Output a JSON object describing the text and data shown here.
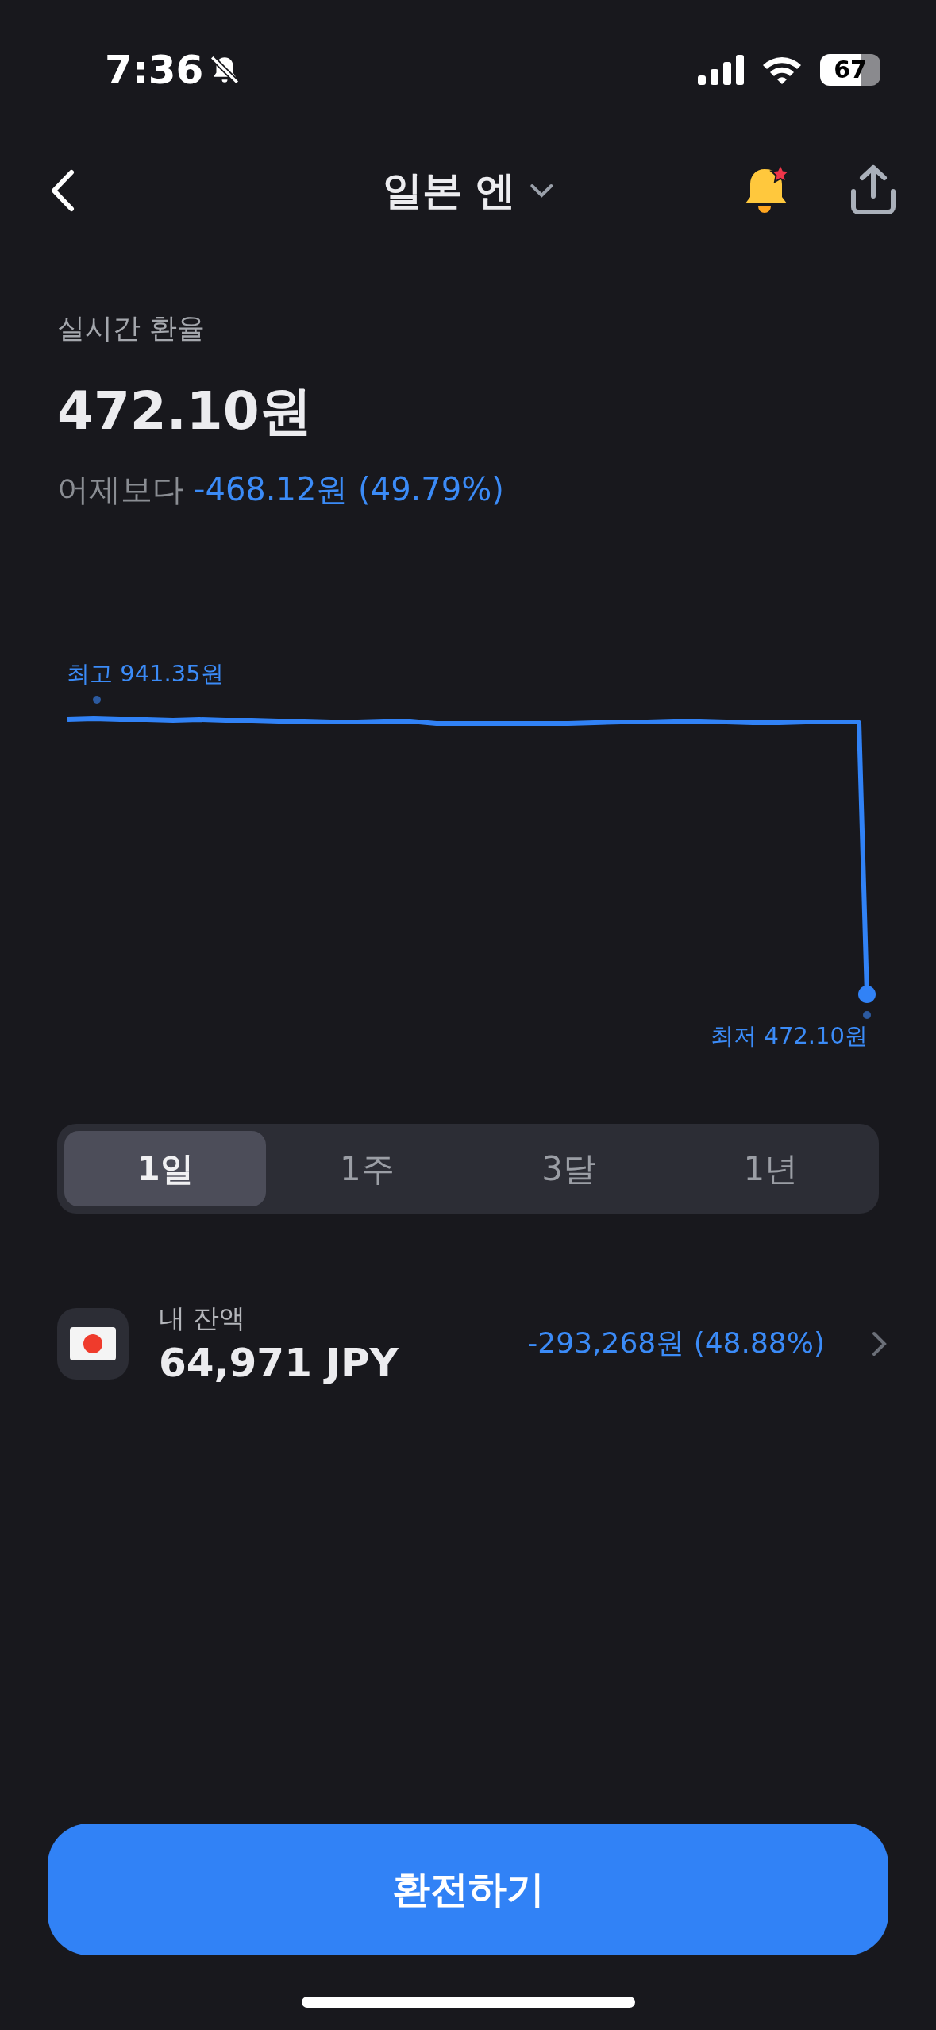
{
  "status_bar": {
    "time": "7:36",
    "battery": "67"
  },
  "nav": {
    "title": "일본 엔"
  },
  "rate": {
    "label": "실시간 환율",
    "value": "472.10원",
    "change_label": "어제보다",
    "change": "-468.12원 (49.79%)"
  },
  "chart": {
    "high_label": "최고 941.35원",
    "low_label": "최저 472.10원"
  },
  "periods": [
    {
      "label": "1일",
      "selected": true
    },
    {
      "label": "1주",
      "selected": false
    },
    {
      "label": "3달",
      "selected": false
    },
    {
      "label": "1년",
      "selected": false
    }
  ],
  "balance": {
    "label": "내 잔액",
    "amount": "64,971 JPY",
    "change": "-293,268원 (48.88%)"
  },
  "primary_button": "환전하기"
}
